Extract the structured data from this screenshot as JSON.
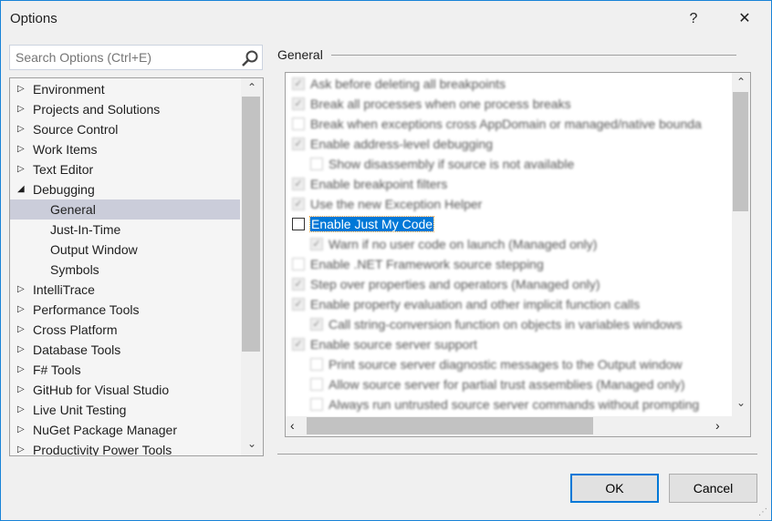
{
  "window": {
    "title": "Options",
    "help": "?",
    "close": "✕"
  },
  "search": {
    "placeholder": "Search Options (Ctrl+E)"
  },
  "tree": [
    {
      "label": "Environment",
      "level": 0,
      "state": "collapsed"
    },
    {
      "label": "Projects and Solutions",
      "level": 0,
      "state": "collapsed"
    },
    {
      "label": "Source Control",
      "level": 0,
      "state": "collapsed"
    },
    {
      "label": "Work Items",
      "level": 0,
      "state": "collapsed"
    },
    {
      "label": "Text Editor",
      "level": 0,
      "state": "collapsed"
    },
    {
      "label": "Debugging",
      "level": 0,
      "state": "expanded"
    },
    {
      "label": "General",
      "level": 1,
      "selected": true
    },
    {
      "label": "Just-In-Time",
      "level": 1
    },
    {
      "label": "Output Window",
      "level": 1
    },
    {
      "label": "Symbols",
      "level": 1
    },
    {
      "label": "IntelliTrace",
      "level": 0,
      "state": "collapsed"
    },
    {
      "label": "Performance Tools",
      "level": 0,
      "state": "collapsed"
    },
    {
      "label": "Cross Platform",
      "level": 0,
      "state": "collapsed"
    },
    {
      "label": "Database Tools",
      "level": 0,
      "state": "collapsed"
    },
    {
      "label": "F# Tools",
      "level": 0,
      "state": "collapsed"
    },
    {
      "label": "GitHub for Visual Studio",
      "level": 0,
      "state": "collapsed"
    },
    {
      "label": "Live Unit Testing",
      "level": 0,
      "state": "collapsed"
    },
    {
      "label": "NuGet Package Manager",
      "level": 0,
      "state": "collapsed"
    },
    {
      "label": "Productivity Power Tools",
      "level": 0,
      "state": "collapsed"
    }
  ],
  "group": {
    "title": "General"
  },
  "options": [
    {
      "label": "Ask before deleting all breakpoints",
      "indent": 0,
      "checked": true,
      "blurred": true
    },
    {
      "label": "Break all processes when one process breaks",
      "indent": 0,
      "checked": true,
      "blurred": true
    },
    {
      "label": "Break when exceptions cross AppDomain or managed/native bounda",
      "indent": 0,
      "checked": false,
      "blurred": true
    },
    {
      "label": "Enable address-level debugging",
      "indent": 0,
      "checked": true,
      "blurred": true
    },
    {
      "label": "Show disassembly if source is not available",
      "indent": 1,
      "checked": false,
      "blurred": true
    },
    {
      "label": "Enable breakpoint filters",
      "indent": 0,
      "checked": true,
      "blurred": true
    },
    {
      "label": "Use the new Exception Helper",
      "indent": 0,
      "checked": true,
      "blurred": true
    },
    {
      "label": "Enable Just My Code",
      "indent": 0,
      "checked": false,
      "blurred": false,
      "focused": true
    },
    {
      "label": "Warn if no user code on launch (Managed only)",
      "indent": 1,
      "checked": true,
      "disabled": true,
      "blurred": true
    },
    {
      "label": "Enable .NET Framework source stepping",
      "indent": 0,
      "checked": false,
      "blurred": true
    },
    {
      "label": "Step over properties and operators (Managed only)",
      "indent": 0,
      "checked": true,
      "blurred": true
    },
    {
      "label": "Enable property evaluation and other implicit function calls",
      "indent": 0,
      "checked": true,
      "blurred": true
    },
    {
      "label": "Call string-conversion function on objects in variables windows",
      "indent": 1,
      "checked": true,
      "blurred": true
    },
    {
      "label": "Enable source server support",
      "indent": 0,
      "checked": true,
      "blurred": true
    },
    {
      "label": "Print source server diagnostic messages to the Output window",
      "indent": 1,
      "checked": false,
      "blurred": true
    },
    {
      "label": "Allow source server for partial trust assemblies (Managed only)",
      "indent": 1,
      "checked": false,
      "blurred": true
    },
    {
      "label": "Always run untrusted source server commands without prompting",
      "indent": 1,
      "checked": false,
      "blurred": true
    }
  ],
  "buttons": {
    "ok": "OK",
    "cancel": "Cancel"
  },
  "colors": {
    "accent": "#0078d7",
    "selection": "#cbcdda"
  }
}
